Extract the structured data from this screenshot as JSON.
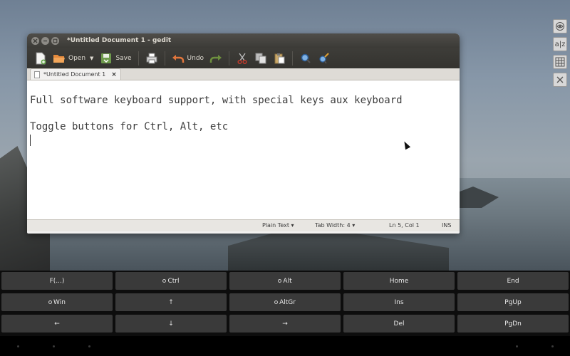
{
  "window": {
    "title": "*Untitled Document 1 - gedit"
  },
  "toolbar": {
    "new_icon": "new-document-icon",
    "open_label": "Open",
    "save_label": "Save",
    "print_icon": "print-icon",
    "undo_label": "Undo",
    "redo_icon": "redo-icon",
    "cut_icon": "cut-icon",
    "copy_icon": "copy-icon",
    "paste_icon": "paste-icon",
    "find_icon": "find-icon",
    "replace_icon": "find-replace-icon"
  },
  "tab": {
    "label": "*Untitled Document 1",
    "close": "×"
  },
  "editor": {
    "lines": [
      "Full software keyboard support, with special keys aux keyboard",
      "",
      "Toggle buttons for Ctrl, Alt, etc",
      ""
    ]
  },
  "statusbar": {
    "language": "Plain Text ▾",
    "tab_width": "Tab Width: 4 ▾",
    "position": "Ln 5, Col 1",
    "mode": "INS"
  },
  "side_dock": {
    "items": [
      "eye-icon",
      "a|z",
      "grid-icon",
      "close-icon"
    ]
  },
  "keyboard": {
    "rows": [
      [
        {
          "label": "F(...)",
          "toggle": false
        },
        {
          "label": "Ctrl",
          "toggle": true
        },
        {
          "label": "Alt",
          "toggle": true
        },
        {
          "label": "Home",
          "toggle": false
        },
        {
          "label": "End",
          "toggle": false
        }
      ],
      [
        {
          "label": "Win",
          "toggle": true
        },
        {
          "label": "↑",
          "toggle": false
        },
        {
          "label": "AltGr",
          "toggle": true
        },
        {
          "label": "Ins",
          "toggle": false
        },
        {
          "label": "PgUp",
          "toggle": false
        }
      ],
      [
        {
          "label": "←",
          "toggle": false
        },
        {
          "label": "↓",
          "toggle": false
        },
        {
          "label": "→",
          "toggle": false
        },
        {
          "label": "Del",
          "toggle": false
        },
        {
          "label": "PgDn",
          "toggle": false
        }
      ]
    ]
  }
}
